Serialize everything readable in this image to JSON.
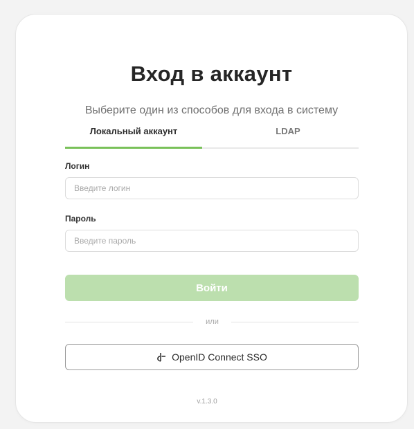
{
  "header": {
    "title": "Вход в аккаунт",
    "subtitle": "Выберите один из способов для входа в систему"
  },
  "tabs": [
    {
      "label": "Локальный аккаунт",
      "active": true
    },
    {
      "label": "LDAP",
      "active": false
    }
  ],
  "form": {
    "login_label": "Логин",
    "login_placeholder": "Введите логин",
    "login_value": "",
    "password_label": "Пароль",
    "password_placeholder": "Введите пароль",
    "password_value": "",
    "submit_label": "Войти"
  },
  "divider_text": "или",
  "sso": {
    "label": "OpenID Connect SSO",
    "icon": "openid-icon"
  },
  "version": "v.1.3.0",
  "colors": {
    "accent": "#79c159",
    "submit_bg": "#bcdfae",
    "background": "#f3f3f3"
  }
}
